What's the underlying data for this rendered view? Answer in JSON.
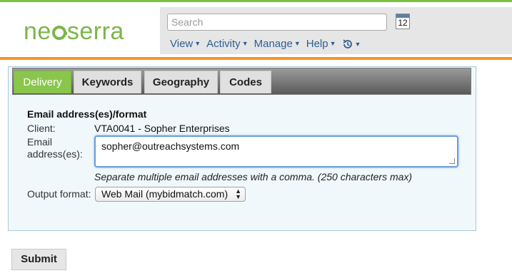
{
  "header": {
    "logo_text": "neoserra",
    "search_placeholder": "Search",
    "calendar_day": "12",
    "menu": [
      {
        "label": "View"
      },
      {
        "label": "Activity"
      },
      {
        "label": "Manage"
      },
      {
        "label": "Help"
      }
    ],
    "history_icon": "history-clock-icon"
  },
  "tabs": [
    {
      "label": "Delivery",
      "active": true
    },
    {
      "label": "Keywords",
      "active": false
    },
    {
      "label": "Geography",
      "active": false
    },
    {
      "label": "Codes",
      "active": false
    }
  ],
  "form": {
    "title": "Email address(es)/format",
    "client_label": "Client:",
    "client_value": "VTA0041 - Sopher Enterprises",
    "email_label_line1": "Email",
    "email_label_line2": "address(es):",
    "email_value": "sopher@outreachsystems.com",
    "hint": "Separate multiple email addresses with a comma. (250 characters max)",
    "output_label": "Output format:",
    "output_value": "Web Mail (mybidmatch.com)"
  },
  "actions": {
    "submit_label": "Submit"
  },
  "colors": {
    "brand_green": "#7ab648",
    "accent_orange": "#f7941d",
    "link_blue": "#2d5f94",
    "active_tab": "#8ac64b"
  }
}
